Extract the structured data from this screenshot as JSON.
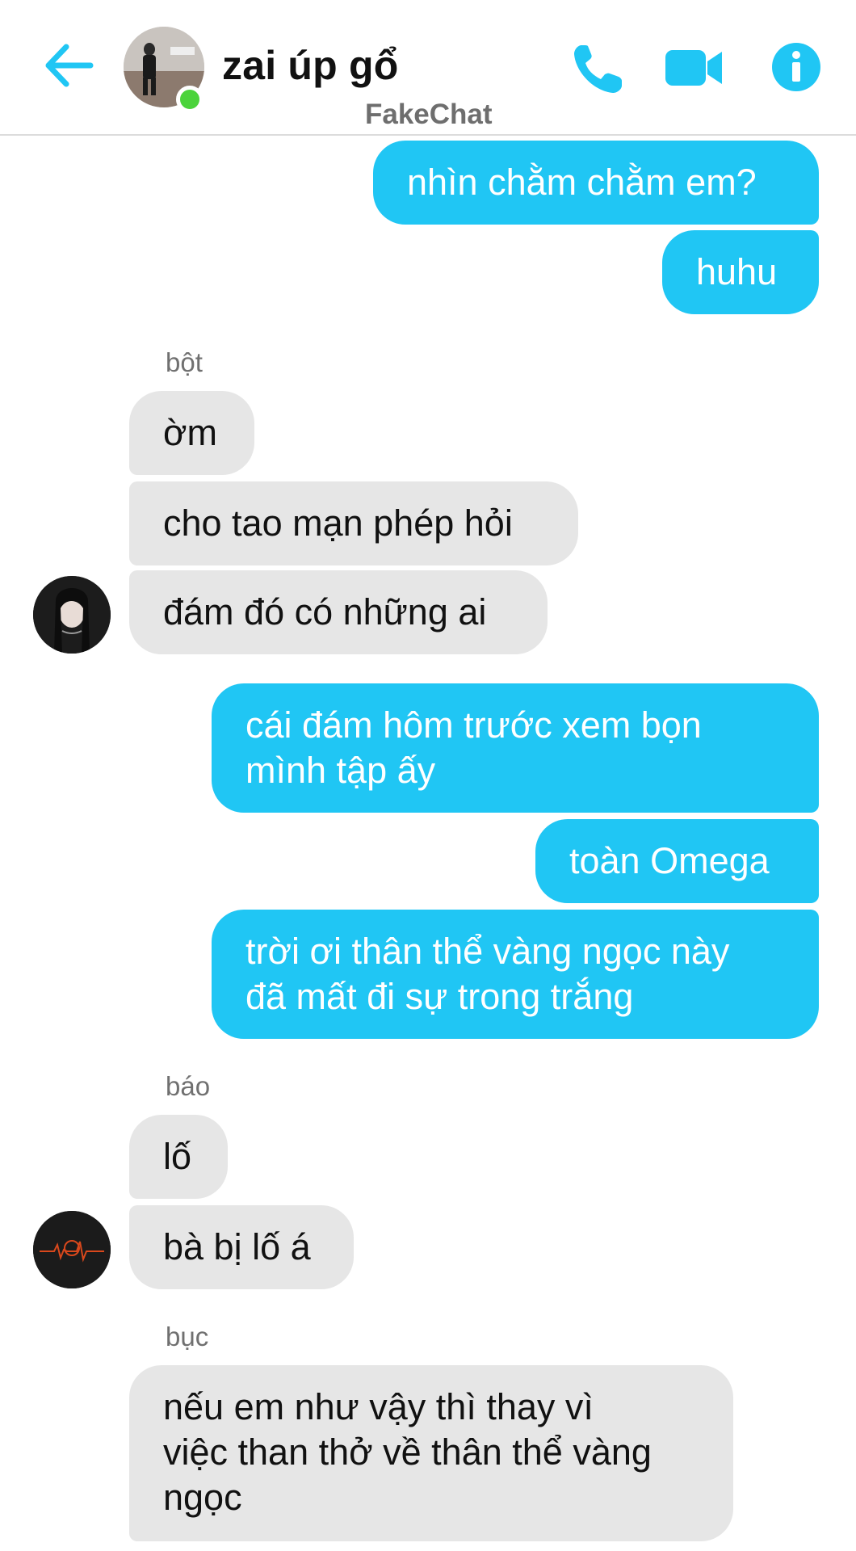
{
  "header": {
    "title": "zai úp gổ",
    "watermark": "FakeChat"
  },
  "messages": {
    "m1": "nhìn chằm chằm em?",
    "m2": "huhu",
    "sender1": "bột",
    "m3": "ờm",
    "m4": "cho tao mạn phép hỏi",
    "m5": "đám đó có những ai",
    "m6a": "cái đám hôm trước xem bọn",
    "m6b": "mình tập ấy",
    "m7": "toàn Omega",
    "m8a": "trời ơi thân thể vàng ngọc này",
    "m8b": "đã mất đi sự trong trắng",
    "sender2": "báo",
    "m9": "lố",
    "m10": "bà bị lố á",
    "sender3": "bục",
    "m11a": "nếu em như vậy thì thay vì",
    "m11b": "việc than thở về thân thể vàng",
    "m11c": "ngọc"
  },
  "colors": {
    "accent": "#20c6f4",
    "incoming_bubble": "#e6e6e6",
    "online": "#4bd33b"
  },
  "icons": [
    "back-arrow-icon",
    "phone-icon",
    "video-camera-icon",
    "info-icon"
  ]
}
